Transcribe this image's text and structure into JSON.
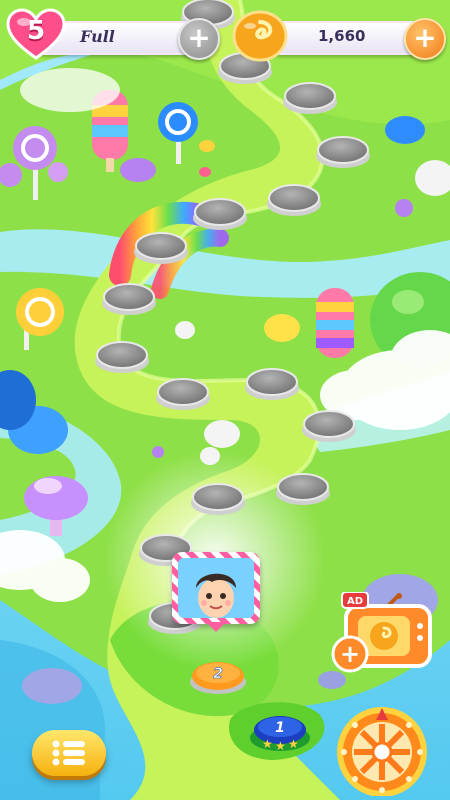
{
  "hud": {
    "lives_count": "5",
    "lives_status": "Full",
    "coin_count": "1,660"
  },
  "map": {
    "current_level": "2",
    "next_level": "1",
    "next_level_stars": 3
  },
  "ad_reward": {
    "badge": "AD"
  },
  "colors": {
    "heart": "#ff4f8b",
    "coin": "#f7a51c",
    "grass": "#7ee03a",
    "river": "#9fe8f6",
    "path": "#c6f25a"
  }
}
